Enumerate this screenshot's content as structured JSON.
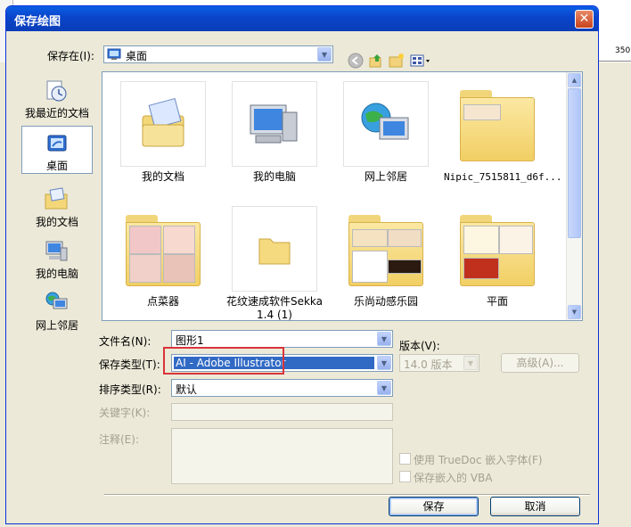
{
  "dialog": {
    "title": "保存绘图",
    "close_glyph": "✕"
  },
  "background": {
    "ruler_number": "350"
  },
  "save_in": {
    "label": "保存在(I):",
    "value": "桌面"
  },
  "places": [
    {
      "label": "我最近的文档",
      "icon": "recent-docs-icon"
    },
    {
      "label": "桌面",
      "icon": "desktop-icon",
      "active": true
    },
    {
      "label": "我的文档",
      "icon": "my-documents-icon"
    },
    {
      "label": "我的电脑",
      "icon": "my-computer-icon"
    },
    {
      "label": "网上邻居",
      "icon": "network-icon"
    }
  ],
  "files": [
    {
      "name": "我的文档",
      "type": "my-documents"
    },
    {
      "name": "我的电脑",
      "type": "my-computer"
    },
    {
      "name": "网上邻居",
      "type": "network"
    },
    {
      "name": "Nipic_7515811_d6f...",
      "type": "folder"
    },
    {
      "name": "点菜器",
      "type": "folder"
    },
    {
      "name": "花纹速成软件Sekka 1.4 (1)",
      "type": "folder"
    },
    {
      "name": "乐尚动感乐园",
      "type": "folder"
    },
    {
      "name": "平面",
      "type": "folder"
    }
  ],
  "form": {
    "filename_label": "文件名(N):",
    "filename_value": "图形1",
    "savetype_label": "保存类型(T):",
    "savetype_value": "AI - Adobe Illustrator",
    "sorttype_label": "排序类型(R):",
    "sorttype_value": "默认",
    "keyword_label": "关键字(K):",
    "notes_label": "注释(E):",
    "version_label": "版本(V):",
    "version_value": "14.0 版本",
    "advanced_label": "高级(A)...",
    "truedoc_label": "使用 TrueDoc 嵌入字体(F)",
    "vba_label": "保存嵌入的 VBA"
  },
  "buttons": {
    "save": "保存",
    "cancel": "取消"
  }
}
